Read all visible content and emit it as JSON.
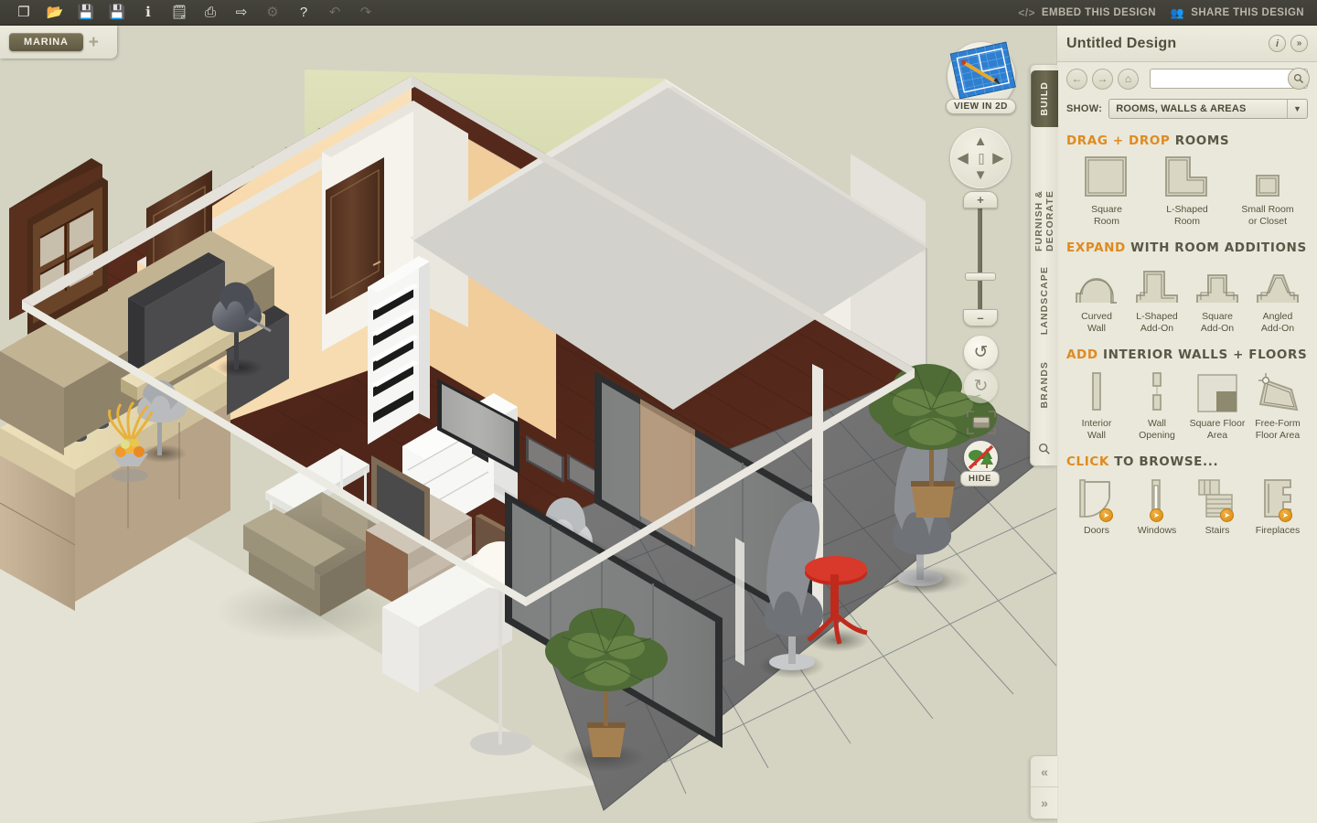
{
  "toolbar": {
    "icons": [
      {
        "name": "new-file-icon",
        "glyph": "❐",
        "dim": false
      },
      {
        "name": "open-folder-icon",
        "glyph": "📂",
        "dim": false
      },
      {
        "name": "save-icon",
        "glyph": "💾",
        "dim": false
      },
      {
        "name": "save-as-icon",
        "glyph": "💾",
        "dim": true
      },
      {
        "name": "info-icon",
        "glyph": "ℹ",
        "dim": false
      },
      {
        "name": "notes-icon",
        "glyph": "🗒",
        "dim": false
      },
      {
        "name": "print-icon",
        "glyph": "⎙",
        "dim": false
      },
      {
        "name": "export-icon",
        "glyph": "⇨",
        "dim": false
      },
      {
        "name": "settings-gear-icon",
        "glyph": "⚙",
        "dim": true
      },
      {
        "name": "help-icon",
        "glyph": "?",
        "dim": false
      },
      {
        "name": "undo-icon",
        "glyph": "↶",
        "dim": true
      },
      {
        "name": "redo-icon",
        "glyph": "↷",
        "dim": true
      }
    ],
    "embed_label": "EMBED THIS DESIGN",
    "embed_icon": "</>",
    "share_label": "SHARE THIS DESIGN",
    "share_icon": "👥"
  },
  "tabbar": {
    "project_tab": "MARINA",
    "add_tab": "+"
  },
  "viewport": {
    "view2d_label": "VIEW IN 2D",
    "pad": {
      "up": "▲",
      "down": "▼",
      "left": "◀",
      "right": "▶",
      "center": "[ ]"
    },
    "zoom_in": "+",
    "zoom_out": "–",
    "rotate_ccw": "↺",
    "rotate_cw": "↻",
    "hide_label": "HIDE"
  },
  "rail": {
    "tabs": [
      {
        "label": "BUILD",
        "active": true
      },
      {
        "label": "FURNISH & DECORATE",
        "active": false
      },
      {
        "label": "LANDSCAPE",
        "active": false
      },
      {
        "label": "BRANDS",
        "active": false
      }
    ],
    "search_icon": "🔍"
  },
  "panel": {
    "title": "Untitled Design",
    "info_icon": "i",
    "collapse_icon": "»",
    "nav": {
      "back_icon": "←",
      "forward_icon": "→",
      "home_icon": "⌂",
      "search_placeholder": "",
      "search_value": "",
      "search_icon": "🔍"
    },
    "show": {
      "label": "SHOW:",
      "selected": "ROOMS, WALLS & AREAS",
      "arrow": "▼"
    },
    "sections": [
      {
        "highlight": "DRAG + DROP",
        "rest": "ROOMS",
        "items": [
          {
            "name": "square-room",
            "caption": "Square\nRoom",
            "shape": "square-room",
            "badge": false
          },
          {
            "name": "l-shaped-room",
            "caption": "L-Shaped\nRoom",
            "shape": "l-room",
            "badge": false
          },
          {
            "name": "small-room-or-closet",
            "caption": "Small Room\nor Closet",
            "shape": "small-room",
            "badge": false
          }
        ]
      },
      {
        "highlight": "EXPAND",
        "rest": "WITH ROOM ADDITIONS",
        "items": [
          {
            "name": "curved-wall",
            "caption": "Curved\nWall",
            "shape": "curved-wall",
            "badge": false
          },
          {
            "name": "l-shaped-add-on",
            "caption": "L-Shaped\nAdd-On",
            "shape": "l-addon",
            "badge": false
          },
          {
            "name": "square-add-on",
            "caption": "Square\nAdd-On",
            "shape": "sq-addon",
            "badge": false
          },
          {
            "name": "angled-add-on",
            "caption": "Angled\nAdd-On",
            "shape": "ang-addon",
            "badge": false
          }
        ]
      },
      {
        "highlight": "ADD",
        "rest": "INTERIOR WALLS + FLOORS",
        "items": [
          {
            "name": "interior-wall",
            "caption": "Interior\nWall",
            "shape": "int-wall",
            "badge": false
          },
          {
            "name": "wall-opening",
            "caption": "Wall\nOpening",
            "shape": "wall-opening",
            "badge": false
          },
          {
            "name": "square-floor-area",
            "caption": "Square Floor\nArea",
            "shape": "sq-floor",
            "badge": false
          },
          {
            "name": "free-form-floor-area",
            "caption": "Free-Form\nFloor Area",
            "shape": "ff-floor",
            "badge": false
          }
        ]
      },
      {
        "highlight": "CLICK",
        "rest": "TO BROWSE...",
        "items": [
          {
            "name": "doors",
            "caption": "Doors",
            "shape": "doors",
            "badge": true
          },
          {
            "name": "windows",
            "caption": "Windows",
            "shape": "windows",
            "badge": true
          },
          {
            "name": "stairs",
            "caption": "Stairs",
            "shape": "stairs",
            "badge": true
          },
          {
            "name": "fireplaces",
            "caption": "Fireplaces",
            "shape": "fireplaces",
            "badge": true
          }
        ]
      }
    ]
  },
  "collapse": {
    "left_icon": "«",
    "right_icon": "»"
  },
  "colors": {
    "accent_orange": "#e08a20",
    "panel_bg": "#e9e8da",
    "toolbar_dark": "#3f3e36",
    "viewport_bg": "#d5d4c3",
    "wall_peach": "#f6d9ab",
    "wall_green": "#d8dcb4",
    "wall_white": "#f2f0ea",
    "floor_wood": "#54291c",
    "balcony_tile": "#6d6d6d"
  }
}
